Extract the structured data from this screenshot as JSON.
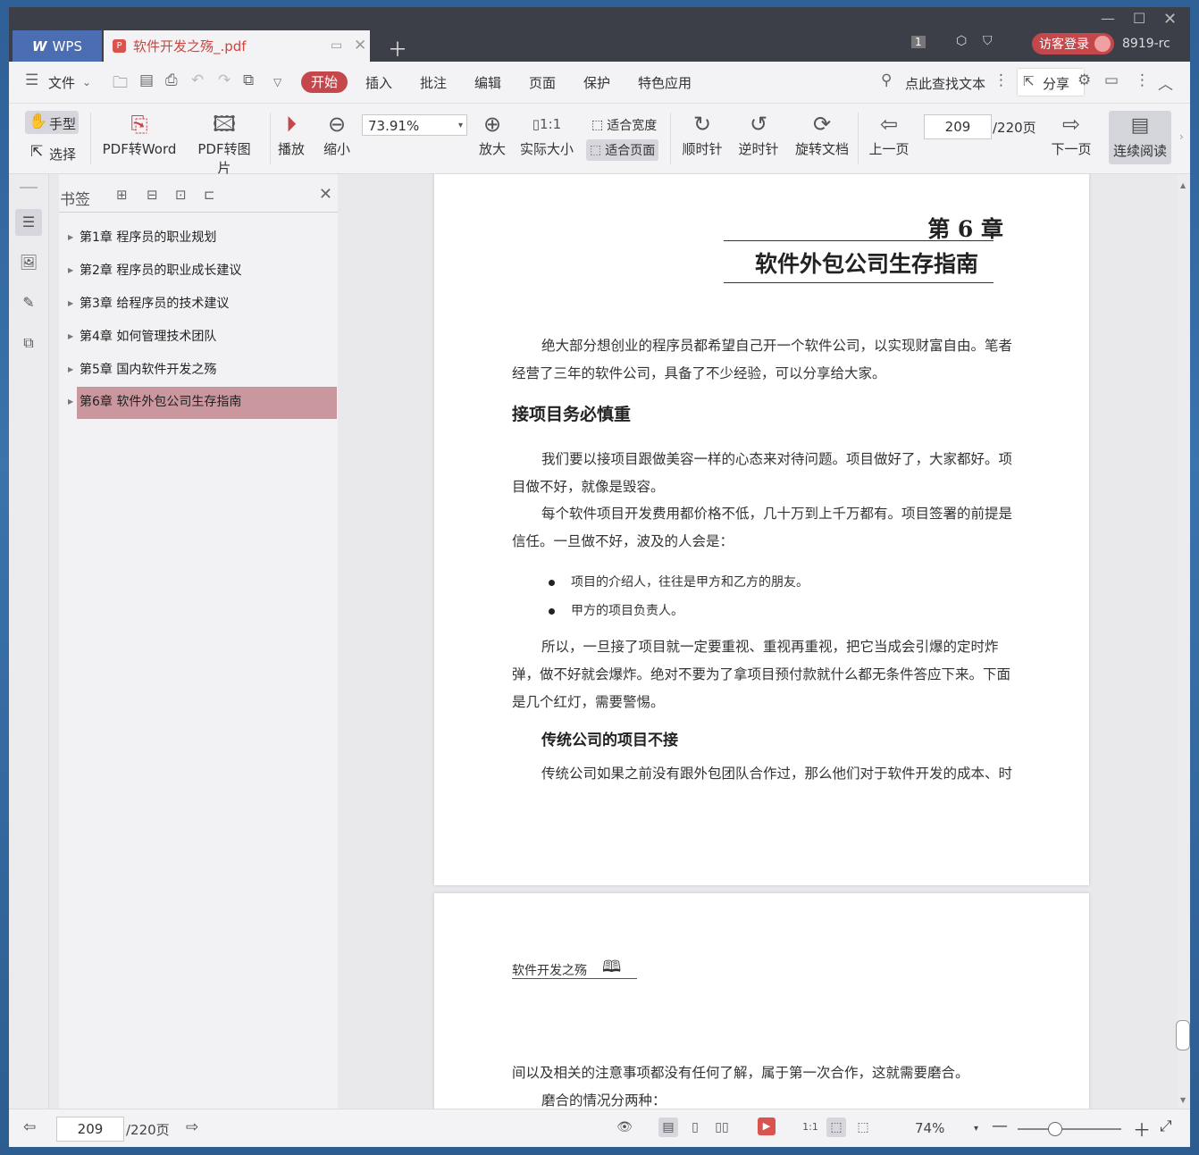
{
  "titlebar": {
    "app_name": "WPS",
    "doc_tab": "软件开发之殇_.pdf",
    "page_badge": "1",
    "login": "访客登录",
    "user": "8919-rc"
  },
  "menubar": {
    "file": "文件",
    "start": "开始",
    "items": [
      "插入",
      "批注",
      "编辑",
      "页面",
      "保护",
      "特色应用"
    ],
    "search": "点此查找文本",
    "share": "分享"
  },
  "toolbar": {
    "hand": "手型",
    "select": "选择",
    "pdf_to_word": "PDF转Word",
    "pdf_to_image": "PDF转图片",
    "play": "播放",
    "zoom_out": "缩小",
    "zoom_value": "73.91%",
    "zoom_in": "放大",
    "actual_size": "实际大小",
    "fit_width": "适合宽度",
    "fit_page": "适合页面",
    "clockwise": "顺时针",
    "counterclockwise": "逆时针",
    "rotate_doc": "旋转文档",
    "prev_page": "上一页",
    "page_current": "209",
    "page_total": "/220页",
    "next_page": "下一页",
    "continuous_read": "连续阅读"
  },
  "bookmarks": {
    "title": "书签",
    "items": [
      {
        "label": "第1章 程序员的职业规划"
      },
      {
        "label": "第2章 程序员的职业成长建议"
      },
      {
        "label": "第3章 给程序员的技术建议"
      },
      {
        "label": "第4章 如何管理技术团队"
      },
      {
        "label": "第5章 国内软件开发之殇"
      },
      {
        "label": "第6章 软件外包公司生存指南"
      }
    ],
    "selected_index": 5
  },
  "document": {
    "chapter_num": "第 6 章",
    "chapter_title": "软件外包公司生存指南",
    "p1": "绝大部分想创业的程序员都希望自己开一个软件公司，以实现财富自由。笔者经营了三年的软件公司，具备了不少经验，可以分享给大家。",
    "h2": "接项目务必慎重",
    "p2": "我们要以接项目跟做美容一样的心态来对待问题。项目做好了，大家都好。项目做不好，就像是毁容。",
    "p3": "每个软件项目开发费用都价格不低，几十万到上千万都有。项目签署的前提是信任。一旦做不好，波及的人会是：",
    "bullets": [
      "项目的介绍人，往往是甲方和乙方的朋友。",
      "甲方的项目负责人。"
    ],
    "p4": "所以，一旦接了项目就一定要重视、重视再重视，把它当成会引爆的定时炸弹，做不好就会爆炸。绝对不要为了拿项目预付款就什么都无条件答应下来。下面是几个红灯，需要警惕。",
    "h3": "传统公司的项目不接",
    "p5": "传统公司如果之前没有跟外包团队合作过，那么他们对于软件开发的成本、时",
    "running_head": "软件开发之殇",
    "p6": "间以及相关的注意事项都没有任何了解，属于第一次合作，这就需要磨合。",
    "p7": "磨合的情况分两种："
  },
  "statusbar": {
    "page_current": "209",
    "page_total": "/220页",
    "zoom": "74%"
  },
  "colors": {
    "accent": "#c4474c",
    "wps_blue": "#4b6db1",
    "selected_bookmark": "#c9979d"
  }
}
